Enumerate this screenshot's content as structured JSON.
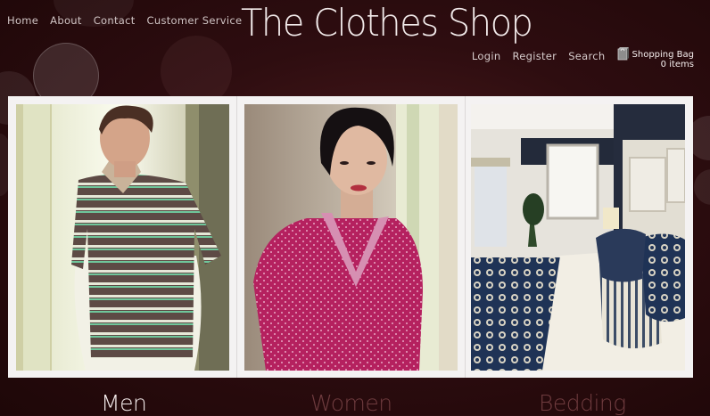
{
  "site": {
    "brand": "The Clothes Shop"
  },
  "top_nav": [
    "Home",
    "About",
    "Contact",
    "Customer Service"
  ],
  "user_nav": {
    "login": "Login",
    "register": "Register",
    "search": "Search",
    "bag_label": "Shopping Bag",
    "bag_count": "0 items"
  },
  "categories": [
    "Men",
    "Women",
    "Bedding"
  ],
  "colors": {
    "background": "#2e0d10",
    "frame": "#f4f2f2",
    "active_category": "#f3eaea",
    "inactive_category": "#6e3b3e"
  },
  "icons": {
    "bag": "shopping-bag-icon"
  }
}
